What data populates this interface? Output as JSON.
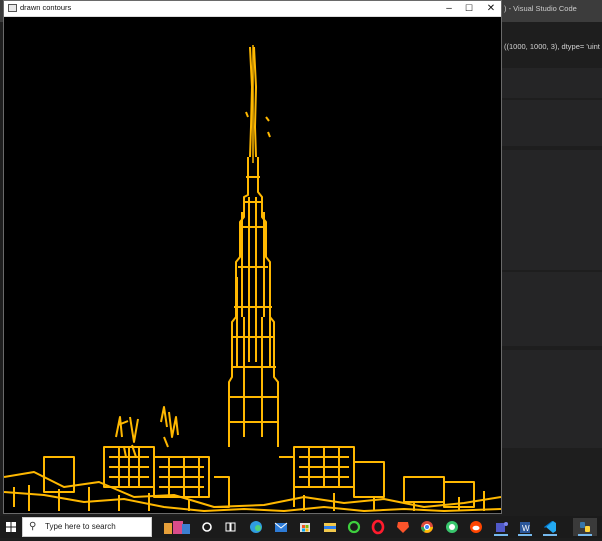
{
  "background_window": {
    "title": ") - Visual Studio Code",
    "code_line": "((1000, 1000, 3), dtype= 'uint"
  },
  "opencv_window": {
    "title": "drawn contours",
    "controls": {
      "minimize": "–",
      "maximize": "☐",
      "close": "✕"
    },
    "contour_color": "#ffb800"
  },
  "taskbar": {
    "search_placeholder": "Type here to search",
    "pinned_icons": [
      "cortana-icon",
      "task-view-icon",
      "edge-icon",
      "mail-icon",
      "store-icon",
      "files-icon",
      "circle-app-icon",
      "opera-icon",
      "brave-icon",
      "chrome-icon",
      "whatsapp-icon",
      "reddit-icon",
      "teams-icon",
      "word-icon",
      "vscode-icon",
      "python-icon"
    ]
  }
}
